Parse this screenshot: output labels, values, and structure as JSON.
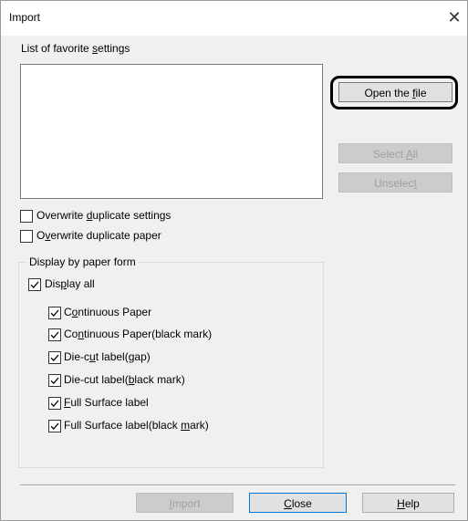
{
  "window": {
    "title": "Import",
    "close_glyph": "✕"
  },
  "favorites": {
    "label_pre": "List of favorite ",
    "label_key": "s",
    "label_post": "ettings"
  },
  "buttons": {
    "open_pre": "Open the ",
    "open_key": "f",
    "open_post": "ile",
    "select_pre": "Select ",
    "select_key": "A",
    "select_post": "ll",
    "unselect_pre": "Unselec",
    "unselect_key": "t",
    "unselect_post": "",
    "import_pre": "",
    "import_key": "I",
    "import_post": "mport",
    "close_pre": "",
    "close_key": "C",
    "close_post": "lose",
    "help_pre": "",
    "help_key": "H",
    "help_post": "elp"
  },
  "options": {
    "overwrite_settings": {
      "pre": "Overwrite ",
      "key": "d",
      "post": "uplicate settings",
      "checked": false
    },
    "overwrite_paper": {
      "pre": "O",
      "key": "v",
      "post": "erwrite duplicate paper",
      "checked": false
    }
  },
  "paper_form": {
    "group_title": "Display by paper form",
    "display_all": {
      "pre": "Dis",
      "key": "p",
      "post": "lay all",
      "checked": true
    },
    "items": [
      {
        "pre": "C",
        "key": "o",
        "post": "ntinuous Paper",
        "checked": true
      },
      {
        "pre": "Co",
        "key": "n",
        "post": "tinuous Paper(black mark)",
        "checked": true
      },
      {
        "pre": "Die-c",
        "key": "u",
        "post": "t label(gap)",
        "checked": true
      },
      {
        "pre": "Die-cut label(",
        "key": "b",
        "post": "lack mark)",
        "checked": true
      },
      {
        "pre": "",
        "key": "F",
        "post": "ull Surface label",
        "checked": true
      },
      {
        "pre": "Full Surface label(black ",
        "key": "m",
        "post": "ark)",
        "checked": true
      }
    ]
  }
}
